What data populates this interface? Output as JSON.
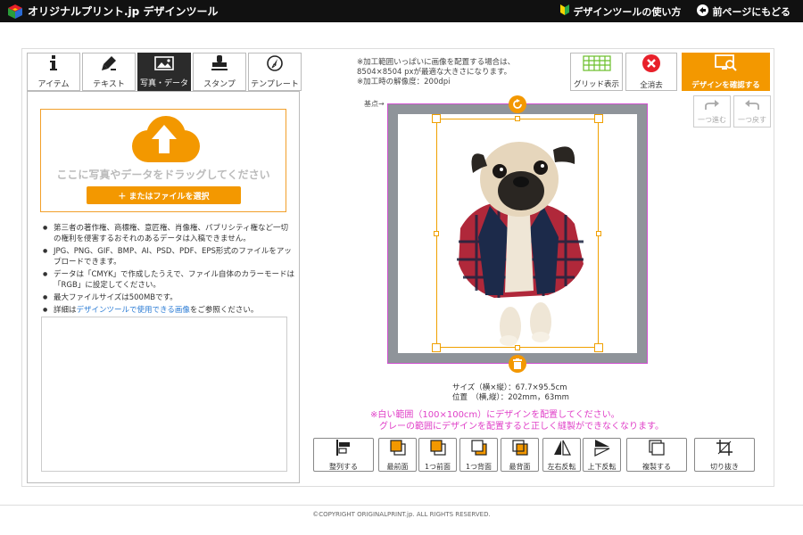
{
  "header": {
    "logo_text": "オリジナルプリント.jp デザインツール",
    "guide_link": "デザインツールの使い方",
    "back_link": "前ページにもどる"
  },
  "tabs": [
    {
      "label": "アイテム",
      "icon": "info-icon"
    },
    {
      "label": "テキスト",
      "icon": "pen-icon"
    },
    {
      "label": "写真・データ",
      "icon": "image-icon",
      "active": true
    },
    {
      "label": "スタンプ",
      "icon": "stamp-icon"
    },
    {
      "label": "テンプレート",
      "icon": "compass-icon"
    }
  ],
  "upload": {
    "drop_text": "ここに写真やデータをドラッグしてください",
    "select_button": "＋ またはファイルを選択"
  },
  "notes": {
    "n1": "第三者の著作権、商標権、意匠権、肖像権、パブリシティ権など一切の権利を侵害するおそれのあるデータは入稿できません。",
    "n2": "JPG、PNG、GIF、BMP、AI、PSD、PDF、EPS形式のファイルをアップロードできます。",
    "n3": "データは「CMYK」で作成したうえで、ファイル自体のカラーモードは「RGB」に設定してください。",
    "n4": "最大ファイルサイズは500MBです。",
    "n5_prefix": "詳細は",
    "n5_link": "デザインツールで使用できる画像",
    "n5_suffix": "をご参照ください。"
  },
  "hint": {
    "line1": "※加工範囲いっぱいに画像を配置する場合は、",
    "line2": "8504×8504 pxが最適な大きさになります。",
    "line3": "※加工時の解像度：200dpi"
  },
  "toolbar": {
    "grid": "グリッド表示",
    "clear": "全消去",
    "confirm": "デザインを確認する",
    "redo": "一つ進む",
    "undo": "一つ戻す"
  },
  "canvas": {
    "origin_label": "基点→"
  },
  "size_info": {
    "size": "サイズ（横×縦）：67.7×95.5cm",
    "position": "位置　（横,縦）：202mm，63mm"
  },
  "warnings": {
    "line1": "※白い範囲（100×100cm）にデザインを配置してください。",
    "line2": "グレーの範囲にデザインを配置すると正しく縫製ができなくなります。"
  },
  "bottom_tools": {
    "align": "整列する",
    "front": "最前面",
    "forward": "1つ前面",
    "backward": "1つ背面",
    "back": "最背面",
    "flip_h": "左右反転",
    "flip_v": "上下反転",
    "duplicate": "複製する",
    "crop": "切り抜き"
  },
  "footer": {
    "copyright": "©COPYRIGHT ORIGINALPRINT.jp. ALL RIGHTS RESERVED."
  },
  "colors": {
    "accent": "#f39800",
    "warning": "#e040c8",
    "canvas_gray": "#8f949a",
    "red": "#e8202a"
  }
}
